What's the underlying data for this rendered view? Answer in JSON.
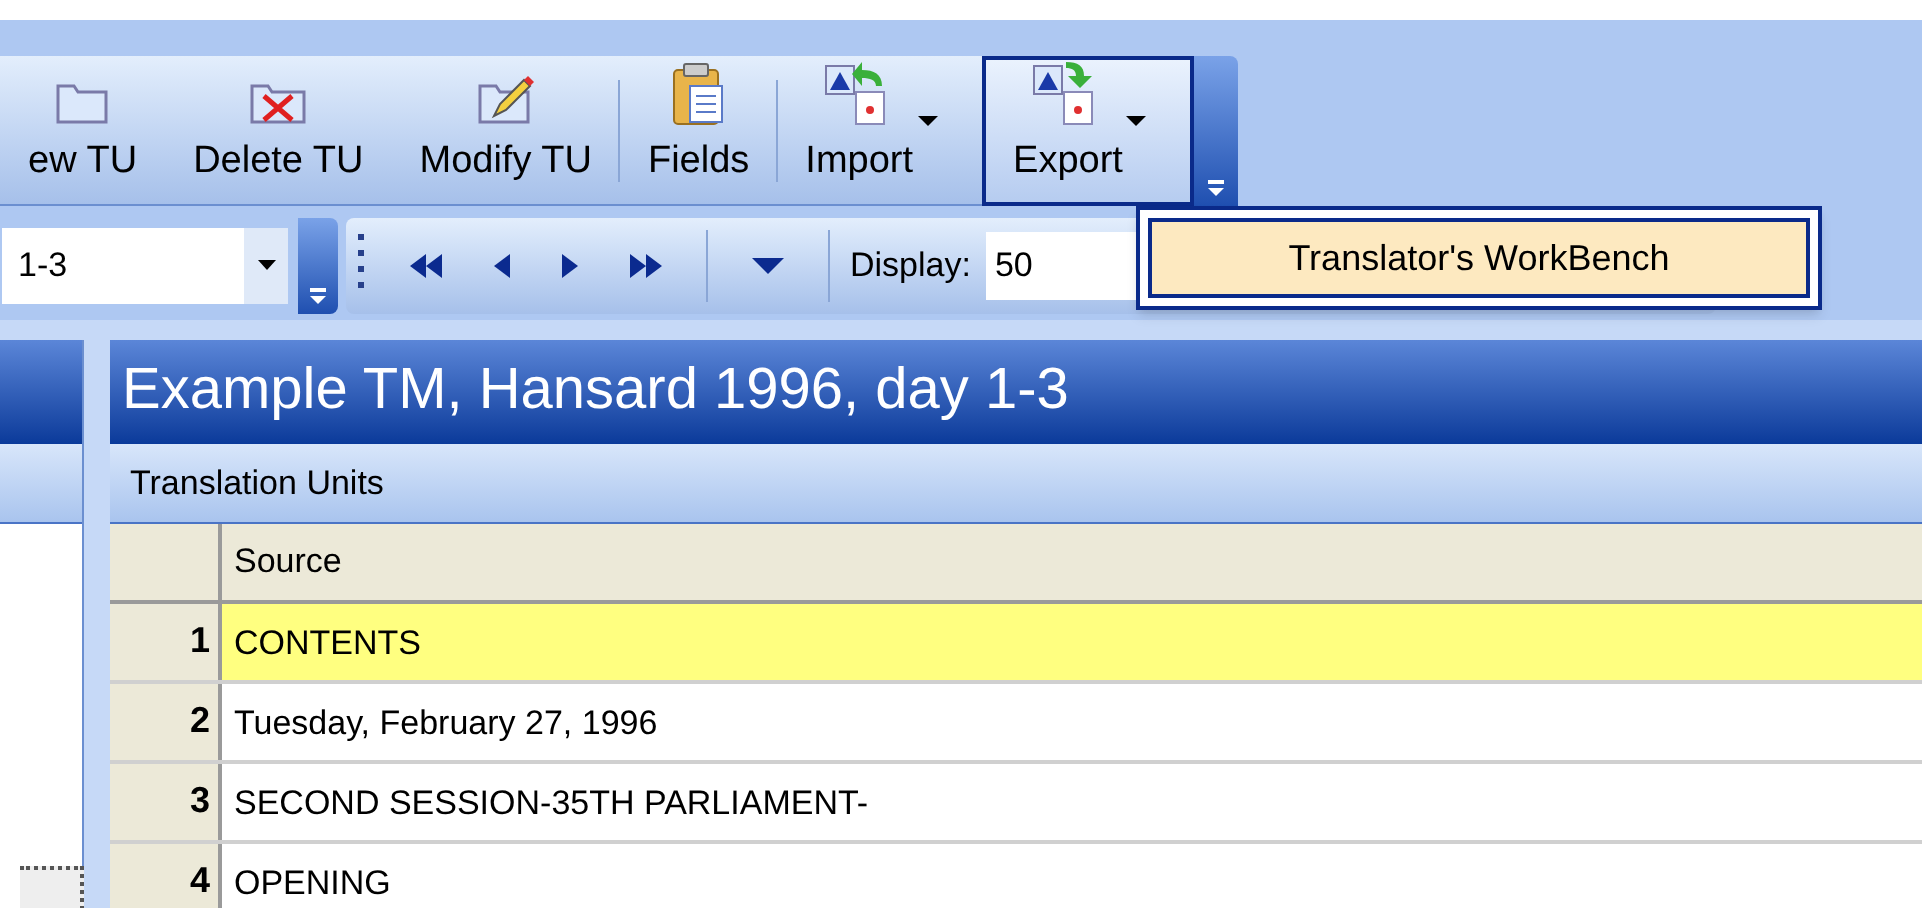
{
  "toolbar": {
    "buttons": [
      {
        "label": "ew TU",
        "kind": "folder",
        "dropdown": false,
        "selected": false,
        "separator_after": false
      },
      {
        "label": "Delete TU",
        "kind": "delete",
        "dropdown": false,
        "selected": false,
        "separator_after": false
      },
      {
        "label": "Modify TU",
        "kind": "modify",
        "dropdown": false,
        "selected": false,
        "separator_after": true
      },
      {
        "label": "Fields",
        "kind": "clipboard",
        "dropdown": false,
        "selected": false,
        "separator_after": true
      },
      {
        "label": "Import",
        "kind": "import",
        "dropdown": true,
        "selected": false,
        "separator_after": false
      },
      {
        "label": "Export",
        "kind": "export",
        "dropdown": true,
        "selected": true,
        "separator_after": false
      }
    ]
  },
  "navigator": {
    "combo_value": "1-3",
    "display_label": "Display:",
    "display_value": "50"
  },
  "export_menu": {
    "items": [
      {
        "label": "Translator's WorkBench",
        "selected": true
      }
    ]
  },
  "panel": {
    "title": "Example TM, Hansard 1996, day 1-3",
    "section": "Translation Units",
    "columns": [
      "Source"
    ],
    "rows": [
      {
        "number": "1",
        "source": "CONTENTS",
        "selected": true
      },
      {
        "number": "2",
        "source": "Tuesday, February 27, 1996",
        "selected": false
      },
      {
        "number": "3",
        "source": "SECOND SESSION-35TH PARLIAMENT-",
        "selected": false
      },
      {
        "number": "4",
        "source": "OPENING",
        "selected": false
      }
    ]
  }
}
